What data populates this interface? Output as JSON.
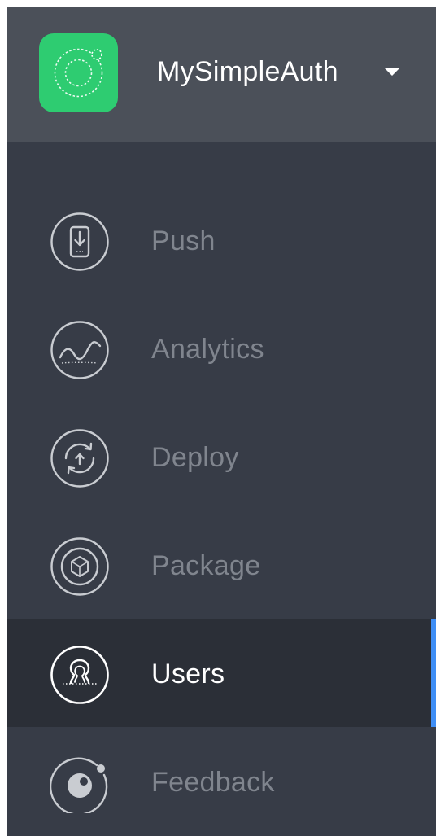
{
  "app": {
    "name": "MySimpleAuth",
    "logo_icon": "ionic-logo-icon",
    "logo_color": "#2ecc71"
  },
  "nav": {
    "items": [
      {
        "label": "Push",
        "icon": "push-notification-icon",
        "active": false
      },
      {
        "label": "Analytics",
        "icon": "analytics-wave-icon",
        "active": false
      },
      {
        "label": "Deploy",
        "icon": "deploy-refresh-icon",
        "active": false
      },
      {
        "label": "Package",
        "icon": "package-cube-icon",
        "active": false
      },
      {
        "label": "Users",
        "icon": "users-group-icon",
        "active": true
      },
      {
        "label": "Feedback",
        "icon": "feedback-orb-icon",
        "active": false
      }
    ]
  },
  "colors": {
    "sidebar_bg": "#373c47",
    "header_bg": "#4b5059",
    "active_bg": "#2b2f37",
    "active_indicator": "#3f8ef5",
    "inactive_text": "#80858e",
    "active_text": "#ffffff"
  }
}
